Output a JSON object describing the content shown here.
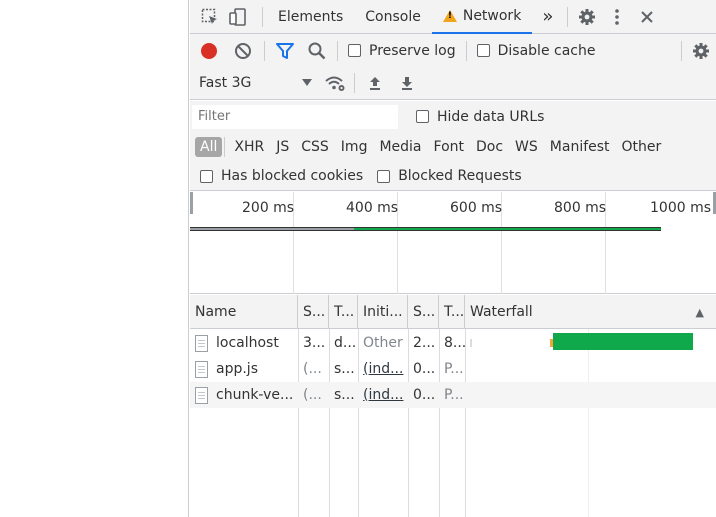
{
  "tabs": {
    "items": [
      {
        "label": "Elements"
      },
      {
        "label": "Console"
      },
      {
        "label": "Network"
      }
    ],
    "more_label": "»"
  },
  "toolbar": {
    "preserve_log": "Preserve log",
    "disable_cache": "Disable cache",
    "throttle_value": "Fast 3G"
  },
  "filter": {
    "placeholder": "Filter",
    "hide_data_urls": "Hide data URLs",
    "types": [
      "All",
      "XHR",
      "JS",
      "CSS",
      "Img",
      "Media",
      "Font",
      "Doc",
      "WS",
      "Manifest",
      "Other"
    ],
    "has_blocked_cookies": "Has blocked cookies",
    "blocked_requests": "Blocked Requests"
  },
  "overview": {
    "ticks": [
      "200 ms",
      "400 ms",
      "600 ms",
      "800 ms",
      "1000 ms"
    ]
  },
  "table": {
    "columns": [
      "Name",
      "S...",
      "T...",
      "Initi...",
      "S...",
      "T...",
      "Waterfall"
    ],
    "sort_indicator": "▲",
    "rows": [
      {
        "name": "localhost",
        "status": "3...",
        "type": "d...",
        "initiator": "Other",
        "size": "2...",
        "time": "8..."
      },
      {
        "name": "app.js",
        "status": "(...",
        "type": "s...",
        "initiator": "(ind...",
        "size": "0...",
        "time": "P..."
      },
      {
        "name": "chunk-ve...",
        "status": "(...",
        "type": "s...",
        "initiator": "(ind...",
        "size": "0...",
        "time": "P..."
      }
    ]
  },
  "colors": {
    "record": "#d93025",
    "filter_blue": "#1a73e8",
    "waterfall_green": "#0fa84a",
    "waiting_orange": "#f2a53b"
  }
}
